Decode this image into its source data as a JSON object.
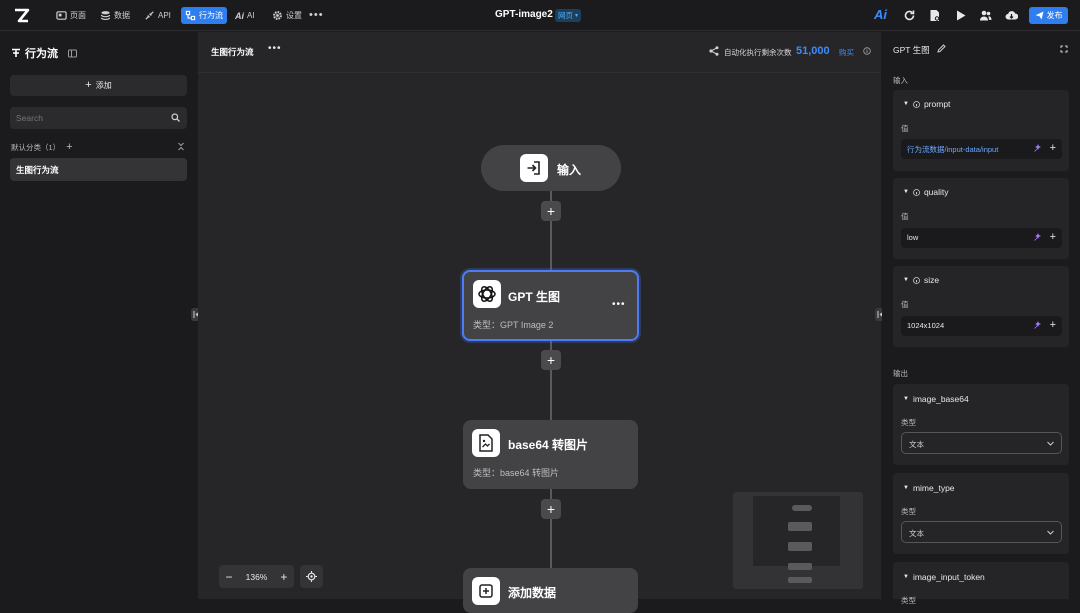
{
  "topbar": {
    "nav": [
      {
        "label": "页面",
        "icon": "page-icon"
      },
      {
        "label": "数据",
        "icon": "database-icon"
      },
      {
        "label": "API",
        "icon": "api-icon"
      },
      {
        "label": "行为流",
        "icon": "flow-icon",
        "active": true
      },
      {
        "label": "AI",
        "icon": "ai-icon"
      },
      {
        "label": "设置",
        "icon": "gear-icon"
      }
    ],
    "app_title": "GPT-image2",
    "platform_badge": "网页",
    "publish_label": "发布",
    "ai_label": "Ai"
  },
  "left_panel": {
    "title": "行为流",
    "add_label": "添加",
    "search_placeholder": "Search",
    "category_label": "默认分类（1）",
    "items": [
      {
        "label": "生图行为流",
        "selected": true
      }
    ]
  },
  "canvas": {
    "flow_title": "生图行为流",
    "quota_label": "自动化执行剩余次数",
    "quota_value": "51,000",
    "buy_label": "购买",
    "zoom": "136%",
    "nodes": [
      {
        "title": "输入"
      },
      {
        "title": "GPT 生图",
        "subtitle": "类型：GPT Image 2",
        "selected": true
      },
      {
        "title": "base64 转图片",
        "subtitle": "类型：base64 转图片"
      },
      {
        "title": "添加数据"
      }
    ]
  },
  "right_panel": {
    "title": "GPT 生图",
    "input_section": "输入",
    "output_section": "输出",
    "value_label": "值",
    "type_label": "类型",
    "inputs": [
      {
        "name": "prompt",
        "value": "行为流数据/input-data/input",
        "value_color": "#6ea8ff"
      },
      {
        "name": "quality",
        "value": "low"
      },
      {
        "name": "size",
        "value": "1024x1024"
      }
    ],
    "outputs": [
      {
        "name": "image_base64",
        "type": "文本"
      },
      {
        "name": "mime_type",
        "type": "文本"
      },
      {
        "name": "image_input_token",
        "type": "类型"
      }
    ]
  },
  "colors": {
    "accent": "#2f7ef0",
    "node_selected_border": "#4d7cf5",
    "quota": "#3b8cff"
  }
}
